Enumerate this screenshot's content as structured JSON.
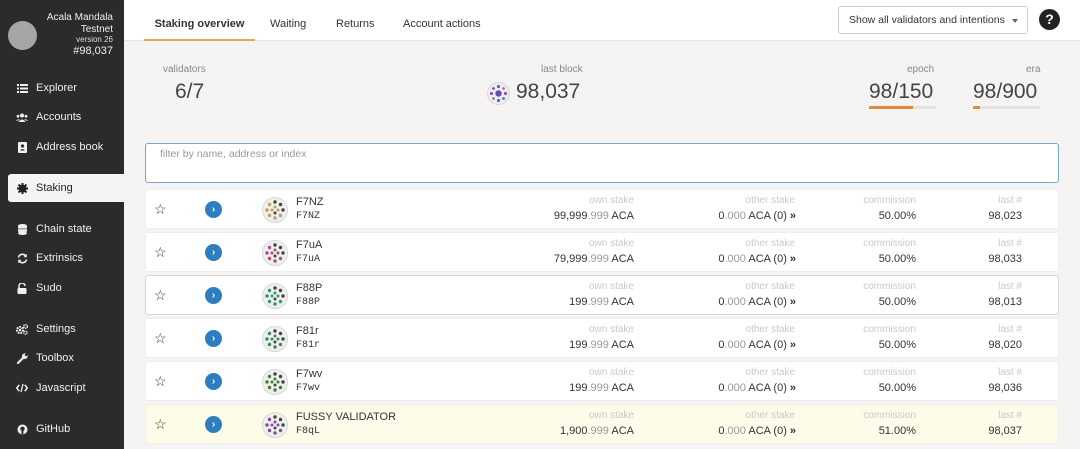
{
  "chain": {
    "name_line1": "Acala Mandala",
    "name_line2": "Testnet",
    "version": "version 26",
    "block": "#98,037"
  },
  "nav": [
    {
      "label": "Explorer",
      "icon": "list-icon"
    },
    {
      "label": "Accounts",
      "icon": "users-icon"
    },
    {
      "label": "Address book",
      "icon": "address-book-icon"
    },
    {
      "label": "Staking",
      "icon": "certificate-icon",
      "active": true
    },
    {
      "label": "Chain state",
      "icon": "database-icon"
    },
    {
      "label": "Extrinsics",
      "icon": "sync-icon"
    },
    {
      "label": "Sudo",
      "icon": "unlock-icon"
    },
    {
      "label": "Settings",
      "icon": "cogs-icon"
    },
    {
      "label": "Toolbox",
      "icon": "wrench-icon"
    },
    {
      "label": "Javascript",
      "icon": "code-icon"
    },
    {
      "label": "GitHub",
      "icon": "github-icon"
    }
  ],
  "tabs": [
    "Staking overview",
    "Waiting",
    "Returns",
    "Account actions"
  ],
  "filter_select": "Show all validators and intentions",
  "help_glyph": "?",
  "summary": {
    "validators_label": "validators",
    "validators_value": "6/7",
    "last_block_label": "last block",
    "last_block_value": "98,037",
    "epoch_label": "epoch",
    "epoch_value": "98/150",
    "epoch_progress": 0.653,
    "era_label": "era",
    "era_value": "98/900",
    "era_progress": 0.109
  },
  "search_placeholder": "filter by name, address or index",
  "columns": {
    "own": "own stake",
    "other": "other stake",
    "commission": "commission",
    "last": "last #"
  },
  "rows": [
    {
      "name": "F7NZ",
      "addr": "F7NZ",
      "own_int": "99,999",
      "own_dec": ".999",
      "own_unit": " ACA",
      "other_int": "0",
      "other_dec": ".000",
      "other_unit": " ACA (0)",
      "commission": "50.00%",
      "last": "98,023",
      "color": "#c89a5a"
    },
    {
      "name": "F7uA",
      "addr": "F7uA",
      "own_int": "79,999",
      "own_dec": ".999",
      "own_unit": " ACA",
      "other_int": "0",
      "other_dec": ".000",
      "other_unit": " ACA (0)",
      "commission": "50.00%",
      "last": "98,033",
      "color": "#b04a8a"
    },
    {
      "name": "F88P",
      "addr": "F88P",
      "own_int": "199",
      "own_dec": ".999",
      "own_unit": " ACA",
      "other_int": "0",
      "other_dec": ".000",
      "other_unit": " ACA (0)",
      "commission": "50.00%",
      "last": "98,013",
      "color": "#2f9a6a"
    },
    {
      "name": "F81r",
      "addr": "F81r",
      "own_int": "199",
      "own_dec": ".999",
      "own_unit": " ACA",
      "other_int": "0",
      "other_dec": ".000",
      "other_unit": " ACA (0)",
      "commission": "50.00%",
      "last": "98,020",
      "color": "#3a8a5a"
    },
    {
      "name": "F7wv",
      "addr": "F7wv",
      "own_int": "199",
      "own_dec": ".999",
      "own_unit": " ACA",
      "other_int": "0",
      "other_dec": ".000",
      "other_unit": " ACA (0)",
      "commission": "50.00%",
      "last": "98,036",
      "color": "#4a7a3a"
    },
    {
      "name": "FUSSY VALIDATOR",
      "addr": "F8qL",
      "own_int": "1,900",
      "own_dec": ".999",
      "own_unit": " ACA",
      "other_int": "0",
      "other_dec": ".000",
      "other_unit": " ACA (0)",
      "commission": "51.00%",
      "last": "98,037",
      "color": "#8a4aa0"
    }
  ]
}
